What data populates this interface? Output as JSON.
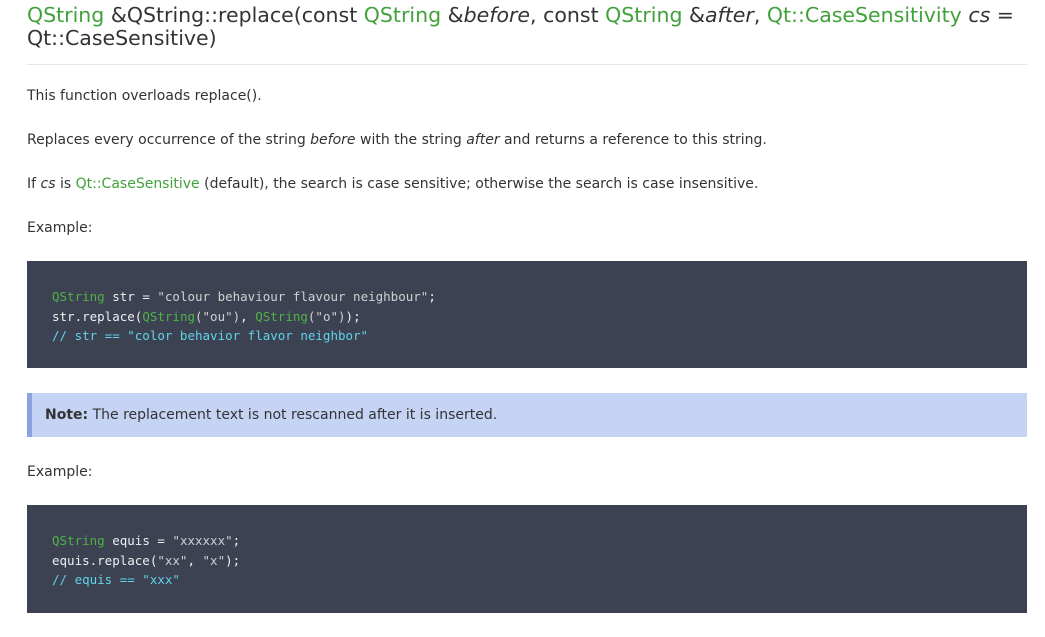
{
  "signature": {
    "return_type": "QString",
    "amp1": " &",
    "func": "QString::replace(",
    "kw_const1": "const ",
    "param1_type": "QString",
    "amp2": " &",
    "param1_name": "before",
    "comma1": ", ",
    "kw_const2": "const ",
    "param2_type": "QString",
    "amp3": " &",
    "param2_name": "after",
    "comma2": ", ",
    "param3_type": "Qt::CaseSensitivity",
    "space": " ",
    "param3_name": "cs",
    "default": " = Qt::CaseSensitive)"
  },
  "paragraphs": {
    "overload": "This function overloads replace().",
    "replaces": {
      "a": "Replaces every occurrence of the string ",
      "b": "before",
      "c": " with the string ",
      "d": "after",
      "e": " and returns a reference to this string."
    },
    "case": {
      "a": "If ",
      "b": "cs",
      "c": " is ",
      "d": "Qt::CaseSensitive",
      "e": " (default), the search is case sensitive; otherwise the search is case insensitive."
    },
    "example1": "Example:",
    "example2": "Example:"
  },
  "code1": {
    "l1_type": "QString",
    "l1_rest": " str = ",
    "l1_str": "\"colour behaviour flavour neighbour\"",
    "l1_end": ";",
    "l2_a": "str.replace(",
    "l2_type1": "QString",
    "l2_s1": "(\"ou\")",
    "l2_b": ", ",
    "l2_type2": "QString",
    "l2_s2": "(\"o\")",
    "l2_end": ");",
    "l3": "// str == \"color behavior flavor neighbor\""
  },
  "note": {
    "label": "Note:",
    "text": " The replacement text is not rescanned after it is inserted."
  },
  "code2": {
    "l1_type": "QString",
    "l1_rest": " equis = ",
    "l1_str": "\"xxxxxx\"",
    "l1_end": ";",
    "l2_a": "equis.replace(",
    "l2_s1": "\"xx\"",
    "l2_b": ", ",
    "l2_s2": "\"x\"",
    "l2_end": ");",
    "l3": "// equis == \"xxx\""
  },
  "colors": {
    "link_green": "#41a13a",
    "code_bg": "#3c4252",
    "note_bg": "#c5d4f4",
    "note_border": "#8aa2dd",
    "comment": "#5fd4e8"
  }
}
